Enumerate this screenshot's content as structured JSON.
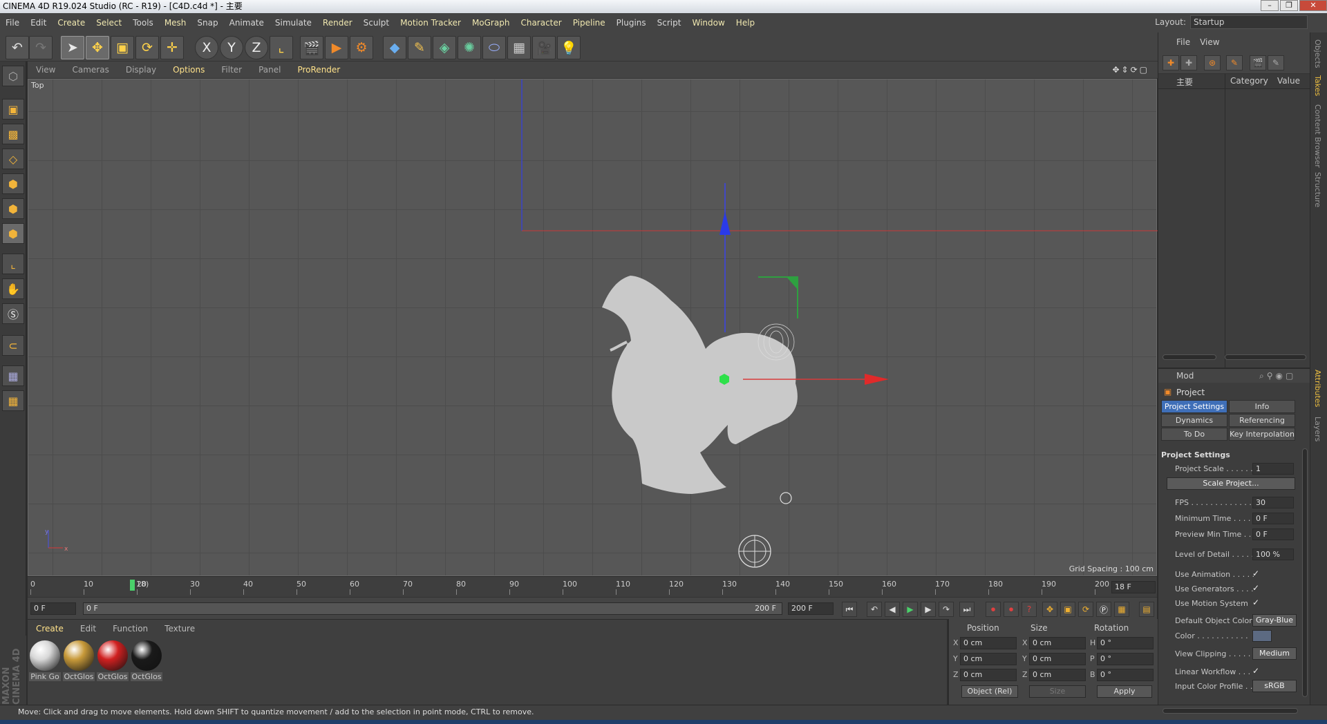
{
  "window": {
    "title": "CINEMA 4D R19.024 Studio (RC - R19) - [C4D.c4d *] - 主要",
    "buttons": [
      "–",
      "❐",
      "✕"
    ]
  },
  "menubar": {
    "items": [
      "File",
      "Edit",
      "Create",
      "Select",
      "Tools",
      "Mesh",
      "Snap",
      "Animate",
      "Simulate",
      "Render",
      "Sculpt",
      "Motion Tracker",
      "MoGraph",
      "Character",
      "Pipeline",
      "Plugins",
      "Script",
      "Window",
      "Help"
    ],
    "layout_label": "Layout:",
    "layout_value": "Startup"
  },
  "toolbar": {
    "icons": [
      "undo-icon",
      "redo-icon",
      "select-arrow-icon",
      "move-icon",
      "scale-icon",
      "rotate-icon",
      "transform-icon",
      "x-axis-lock-icon",
      "y-axis-lock-icon",
      "z-axis-lock-icon",
      "coordinate-system-icon",
      "render-view-icon",
      "render-picture-viewer-icon",
      "render-settings-icon",
      "cube-icon",
      "pen-spline-icon",
      "subdivision-icon",
      "mograph-cloner-icon",
      "deformer-icon",
      "floor-icon",
      "camera-icon",
      "light-icon"
    ],
    "axis_labels": [
      "X",
      "Y",
      "Z"
    ]
  },
  "viewport": {
    "menu": [
      "View",
      "Cameras",
      "Display",
      "Options",
      "Filter",
      "Panel",
      "ProRender"
    ],
    "active_menu": "Options",
    "label": "Top",
    "grid_spacing": "Grid Spacing : 100 cm",
    "axis_labels": [
      "y",
      "x"
    ]
  },
  "timeline": {
    "ticks": [
      "0",
      "10",
      "20",
      "30",
      "40",
      "50",
      "60",
      "70",
      "80",
      "90",
      "100",
      "110",
      "120",
      "130",
      "140",
      "150",
      "160",
      "170",
      "180",
      "190",
      "200"
    ],
    "current": "18",
    "current_label": "18)",
    "frame_field": "18 F"
  },
  "playback": {
    "start_field": "0 F",
    "range_start": "0 F",
    "range_end": "200 F",
    "end_field": "200 F"
  },
  "materials": {
    "menu": [
      "Create",
      "Edit",
      "Function",
      "Texture"
    ],
    "items": [
      {
        "name": "Pink Go",
        "color": "#d8d8d8"
      },
      {
        "name": "OctGlos",
        "color": "#c89a3a"
      },
      {
        "name": "OctGlos",
        "color": "#d02020"
      },
      {
        "name": "OctGlos",
        "color": "#1a1a1a"
      }
    ],
    "brand": "MAXON CINEMA 4D"
  },
  "coordinates": {
    "headers": [
      "Position",
      "Size",
      "Rotation"
    ],
    "rows": [
      {
        "axis": "X",
        "pos": "0 cm",
        "size_axis": "X",
        "size": "0 cm",
        "rot_axis": "H",
        "rot": "0 °"
      },
      {
        "axis": "Y",
        "pos": "0 cm",
        "size_axis": "Y",
        "size": "0 cm",
        "rot_axis": "P",
        "rot": "0 °"
      },
      {
        "axis": "Z",
        "pos": "0 cm",
        "size_axis": "Z",
        "size": "0 cm",
        "rot_axis": "B",
        "rot": "0 °"
      }
    ],
    "mode": "Object (Rel)",
    "size_mode": "Size",
    "apply": "Apply"
  },
  "status": "Move: Click and drag to move elements. Hold down SHIFT to quantize movement / add to the selection in point mode, CTRL to remove.",
  "objects_panel": {
    "menu": [
      "File",
      "View"
    ],
    "col_name": "主要",
    "col_category": "Category",
    "col_value": "Value"
  },
  "attributes": {
    "menu": "Mod",
    "object": "Project",
    "tabs": [
      "Project Settings",
      "Info",
      "Dynamics",
      "Referencing",
      "To Do",
      "Key Interpolation"
    ],
    "section": "Project Settings",
    "rows": [
      {
        "label": "Project Scale . . . . . . .",
        "value": "1"
      },
      {
        "label": "Scale Project...",
        "type": "button"
      },
      {
        "label": "FPS . . . . . . . . . . . . . .",
        "value": "30"
      },
      {
        "label": "Minimum Time . . . . .",
        "value": "0 F"
      },
      {
        "label": "Preview Min Time . . .",
        "value": "0 F"
      },
      {
        "label": "Level of Detail . . . . .",
        "value": "100 %"
      },
      {
        "label": "Use Animation . . . . .",
        "check": "✓"
      },
      {
        "label": "Use Generators . . . .",
        "check": "✓"
      },
      {
        "label": "Use Motion System",
        "check": "✓"
      },
      {
        "label": "Default Object Color",
        "button": "Gray-Blue"
      },
      {
        "label": "Color . . . . . . . . . . .",
        "value": ""
      },
      {
        "label": "View Clipping . . . . .",
        "button": "Medium"
      },
      {
        "label": "Linear Workflow . . .",
        "check": "✓"
      },
      {
        "label": "Input Color Profile . .",
        "button": "sRGB"
      }
    ]
  },
  "side_tabs": [
    "Objects",
    "Takes",
    "Content Browser",
    "Structure",
    "Attributes",
    "Layers"
  ]
}
